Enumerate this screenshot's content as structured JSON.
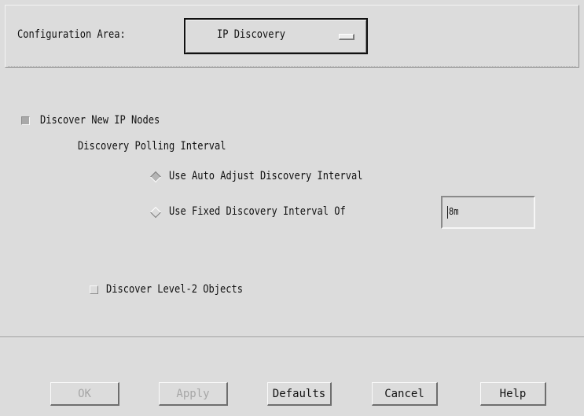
{
  "config_area": {
    "label": "Configuration Area:",
    "selected": "IP Discovery"
  },
  "options": {
    "discover_new_ip_nodes": {
      "label": "Discover New IP Nodes",
      "checked": true
    },
    "polling_interval_heading": "Discovery Polling Interval",
    "auto_adjust": {
      "label": "Use Auto Adjust Discovery Interval",
      "selected": true
    },
    "fixed_interval": {
      "label": "Use Fixed Discovery Interval Of",
      "selected": false,
      "value": "8m"
    },
    "discover_level2": {
      "label": "Discover Level-2 Objects",
      "checked": false
    }
  },
  "buttons": {
    "ok": "OK",
    "apply": "Apply",
    "defaults": "Defaults",
    "cancel": "Cancel",
    "help": "Help"
  },
  "colors": {
    "background": "#dcdcdc",
    "disabled_text": "#a6a6a6"
  }
}
